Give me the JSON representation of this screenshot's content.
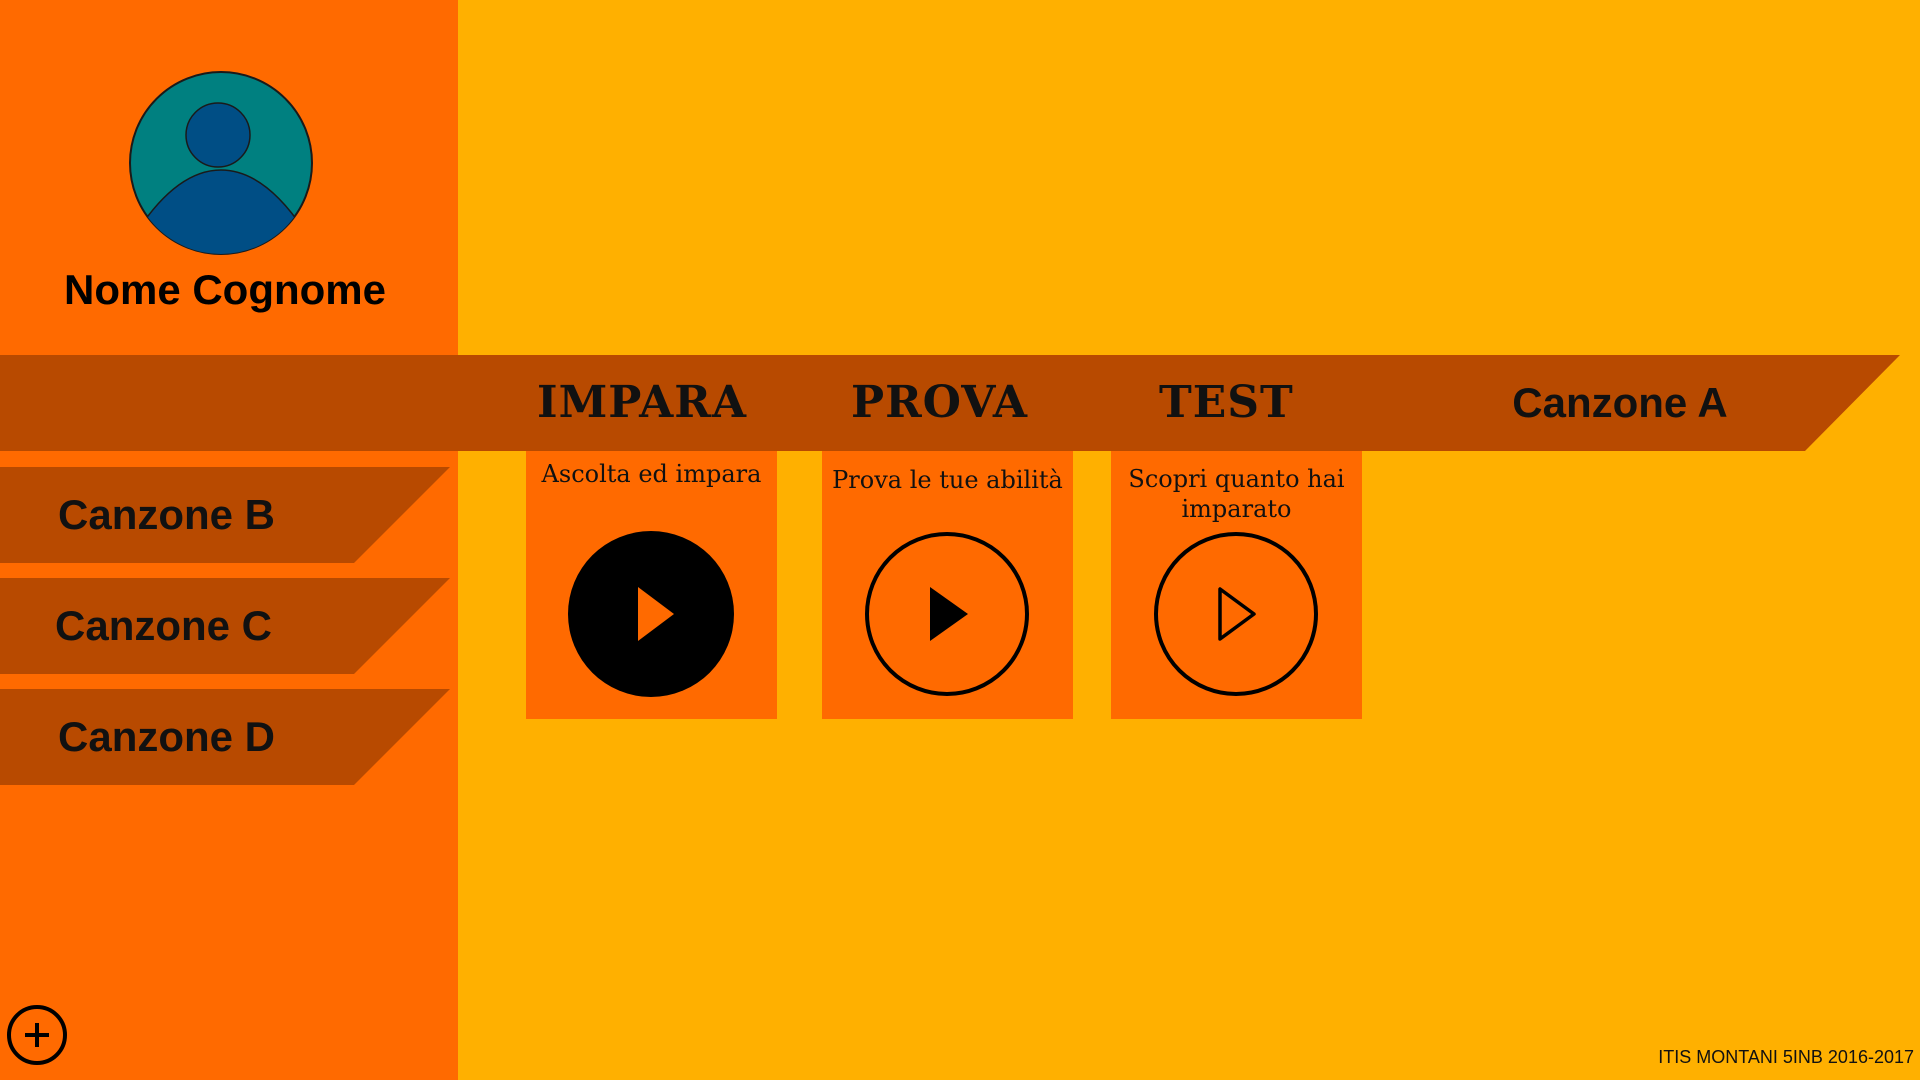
{
  "profile": {
    "name": "Nome Cognome",
    "avatar_icon": "user-avatar-icon"
  },
  "tabs": [
    {
      "label": "IMPARA",
      "description": "Ascolta ed impara",
      "icon": "play-icon-filled"
    },
    {
      "label": "PROVA",
      "description": "Prova le tue abilità",
      "icon": "play-icon-outline-circle"
    },
    {
      "label": "TEST",
      "description": "Scopri quanto hai imparato",
      "icon": "play-icon-outline"
    }
  ],
  "current_song": "Canzone A",
  "songs": [
    {
      "label": "Canzone B"
    },
    {
      "label": "Canzone C"
    },
    {
      "label": "Canzone D"
    }
  ],
  "add_icon": "plus-icon",
  "footer": "ITIS MONTANI 5INB 2016-2017",
  "colors": {
    "background": "#FFB000",
    "sidebar": "#FF6A00",
    "banner": "#B84A00",
    "card": "#FF6A00",
    "avatar_circle": "#008080",
    "avatar_figure": "#004E85"
  }
}
